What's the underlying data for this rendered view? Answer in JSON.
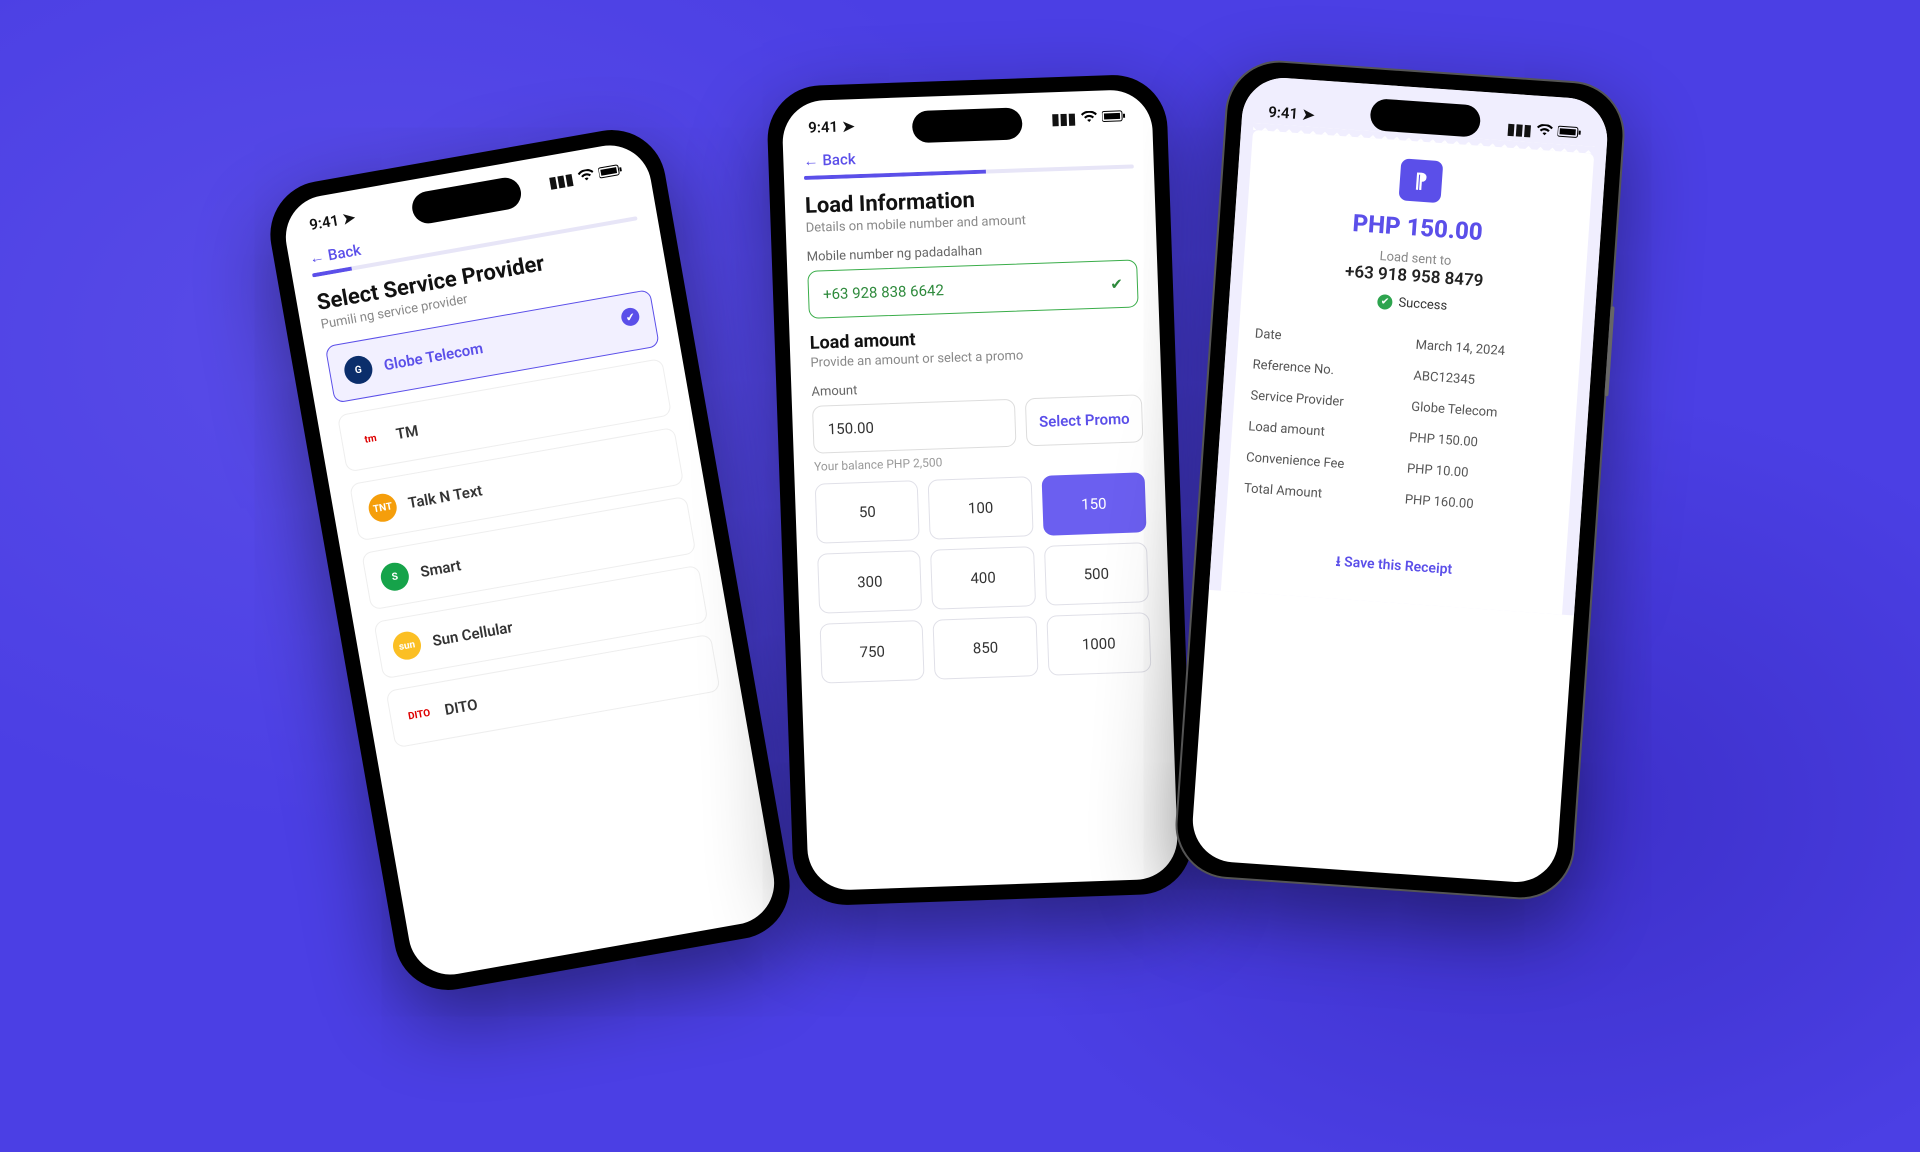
{
  "statusbar": {
    "time": "9:41"
  },
  "common": {
    "back_label": "Back"
  },
  "screen1": {
    "title": "Select Service Provider",
    "subtitle": "Pumili ng service provider",
    "providers": [
      {
        "name": "Globe Telecom",
        "selected": true,
        "logo_bg": "#0b2e6b",
        "logo_txt": "G"
      },
      {
        "name": "TM",
        "selected": false,
        "logo_bg": "#ffffff",
        "logo_txt": "tm"
      },
      {
        "name": "Talk N Text",
        "selected": false,
        "logo_bg": "#f59e0b",
        "logo_txt": "TNT"
      },
      {
        "name": "Smart",
        "selected": false,
        "logo_bg": "#16a34a",
        "logo_txt": "S"
      },
      {
        "name": "Sun Cellular",
        "selected": false,
        "logo_bg": "#fbbf24",
        "logo_txt": "sun"
      },
      {
        "name": "DITO",
        "selected": false,
        "logo_bg": "#ffffff",
        "logo_txt": "DITO"
      }
    ]
  },
  "screen2": {
    "title": "Load Information",
    "subtitle": "Details on mobile number and amount",
    "mobile_label": "Mobile number ng padadalhan",
    "mobile_value": "+63 928 838 6642",
    "load_amount_title": "Load amount",
    "load_amount_sub": "Provide an amount or select a promo",
    "amount_label": "Amount",
    "amount_value": "150.00",
    "select_promo": "Select Promo",
    "balance_hint": "Your balance PHP 2,500",
    "amounts": [
      "50",
      "100",
      "150",
      "300",
      "400",
      "500",
      "750",
      "850",
      "1000"
    ],
    "selected_amount": "150"
  },
  "screen3": {
    "amount_big": "PHP 150.00",
    "sent_to_label": "Load sent to",
    "sent_to_number": "+63 918 958 8479",
    "status": "Success",
    "rows": [
      {
        "k": "Date",
        "v": "March 14, 2024"
      },
      {
        "k": "Reference No.",
        "v": "ABC12345"
      },
      {
        "k": "Service Provider",
        "v": "Globe Telecom"
      },
      {
        "k": "Load amount",
        "v": "PHP 150.00"
      },
      {
        "k": "Convenience Fee",
        "v": "PHP 10.00"
      },
      {
        "k": "Total Amount",
        "v": "PHP 160.00"
      }
    ],
    "save_receipt": "Save this Receipt"
  }
}
